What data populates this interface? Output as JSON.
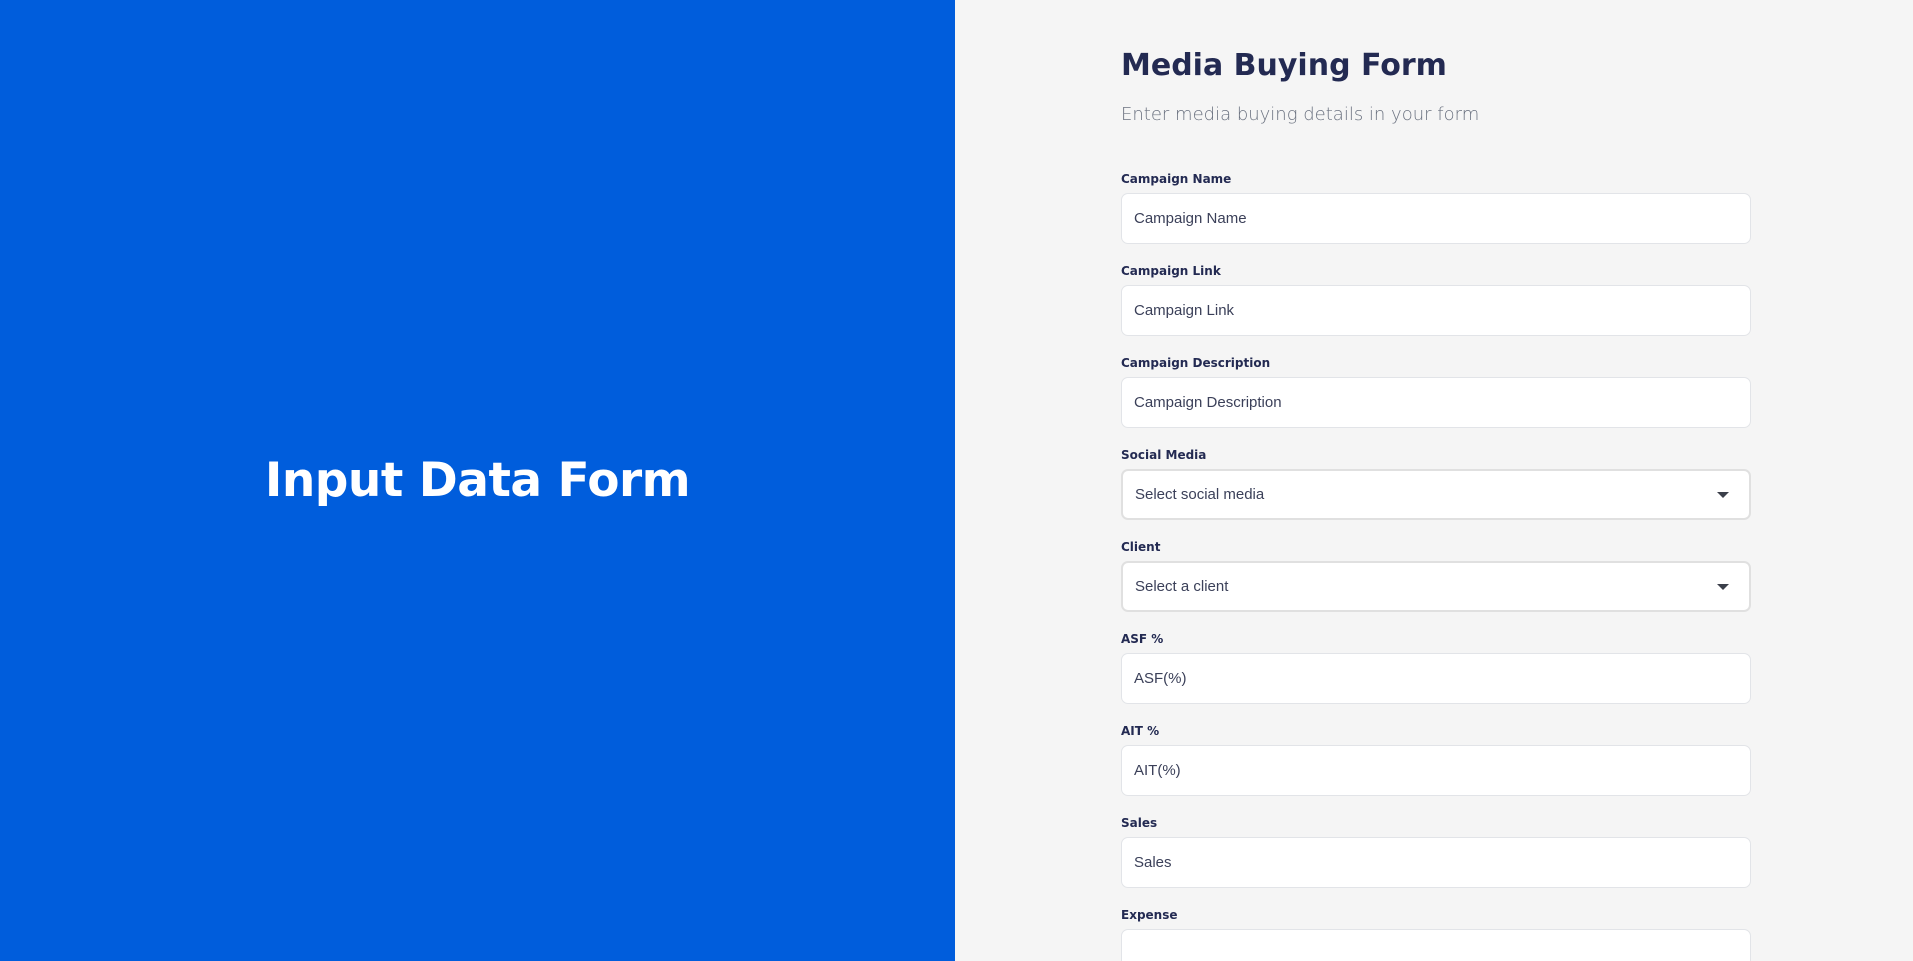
{
  "left_panel": {
    "title": "Input Data Form",
    "background": "#005ddc"
  },
  "form": {
    "title": "Media Buying Form",
    "subtitle": "Enter media buying details in your form",
    "fields": [
      {
        "label": "Campaign Name",
        "type": "text",
        "placeholder": "Campaign Name"
      },
      {
        "label": "Campaign Link",
        "type": "text",
        "placeholder": "Campaign Link"
      },
      {
        "label": "Campaign Description",
        "type": "text",
        "placeholder": "Campaign Description"
      },
      {
        "label": "Social Media",
        "type": "select",
        "placeholder": "Select social media",
        "icon": "chevron-down-icon"
      },
      {
        "label": "Client",
        "type": "select",
        "placeholder": "Select a client",
        "icon": "chevron-down-icon"
      },
      {
        "label": "ASF %",
        "type": "text",
        "placeholder": "ASF(%)"
      },
      {
        "label": "AIT %",
        "type": "text",
        "placeholder": "AIT(%)"
      },
      {
        "label": "Sales",
        "type": "text",
        "placeholder": "Sales"
      },
      {
        "label": "Expense",
        "type": "text",
        "placeholder": ""
      }
    ]
  }
}
